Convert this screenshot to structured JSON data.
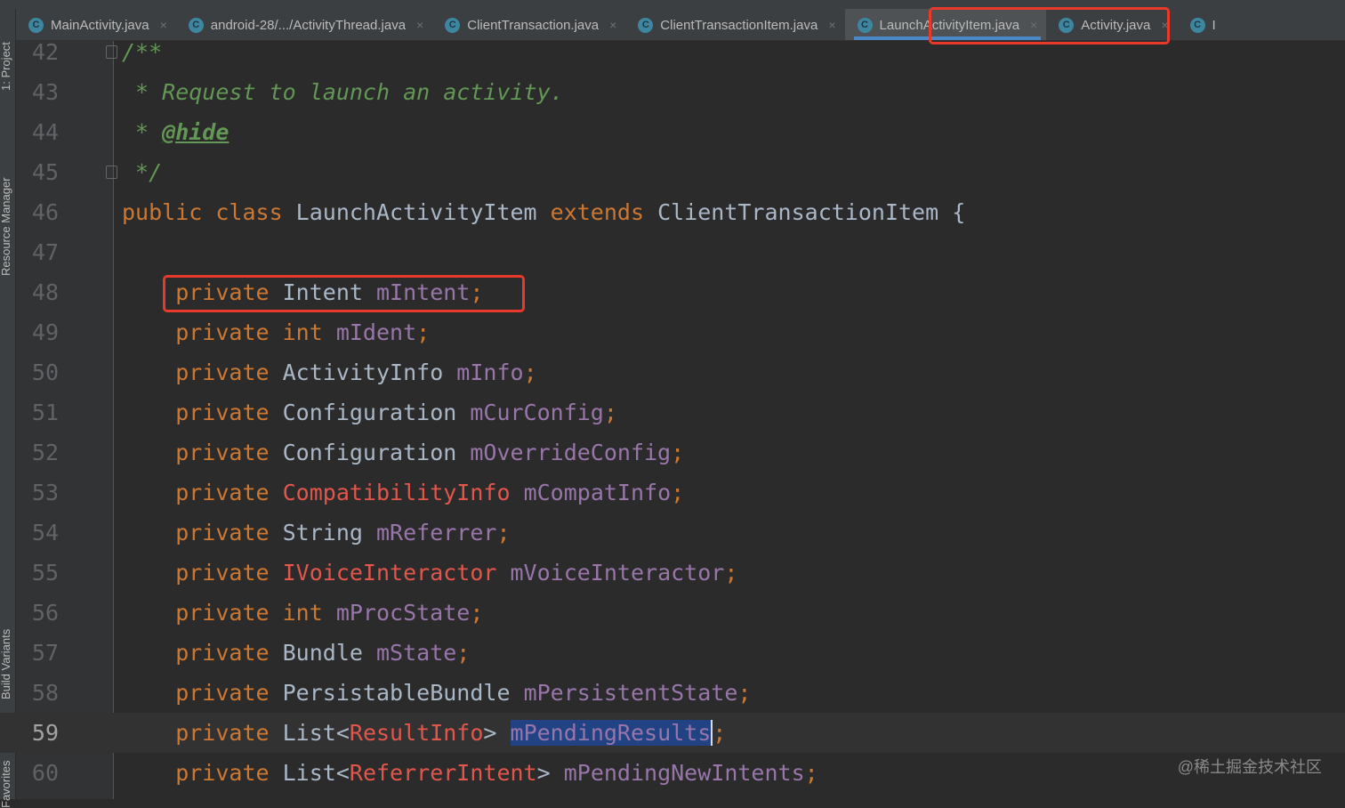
{
  "sidebar": {
    "items": [
      "1: Project",
      "Resource Manager",
      "Build Variants",
      "Favorites"
    ]
  },
  "tabs": [
    {
      "label": "MainActivity.java",
      "icon": "class-icon",
      "active": false
    },
    {
      "label": "android-28/.../ActivityThread.java",
      "icon": "class-icon",
      "active": false
    },
    {
      "label": "ClientTransaction.java",
      "icon": "class-icon",
      "active": false
    },
    {
      "label": "ClientTransactionItem.java",
      "icon": "abstract-class-icon",
      "active": false
    },
    {
      "label": "LaunchActivityItem.java",
      "icon": "class-icon",
      "active": true
    },
    {
      "label": "Activity.java",
      "icon": "class-icon",
      "active": false
    },
    {
      "label": "I",
      "icon": "class-icon",
      "active": false
    }
  ],
  "tab_close": "×",
  "icon_letter": "C",
  "code": {
    "current_line": "59",
    "lines": [
      {
        "n": "42",
        "t": [
          [
            "cm",
            "/**"
          ]
        ]
      },
      {
        "n": "43",
        "t": [
          [
            "cm",
            " * Request to launch an activity."
          ]
        ]
      },
      {
        "n": "44",
        "t": [
          [
            "cm",
            " * "
          ],
          [
            "tag",
            "@hide"
          ]
        ]
      },
      {
        "n": "45",
        "t": [
          [
            "cm",
            " */"
          ]
        ]
      },
      {
        "n": "46",
        "t": [
          [
            "kw",
            "public class "
          ],
          [
            "cls",
            "LaunchActivityItem "
          ],
          [
            "kw",
            "extends "
          ],
          [
            "cls",
            "ClientTransactionItem {"
          ]
        ]
      },
      {
        "n": "47",
        "t": []
      },
      {
        "n": "48",
        "t": [
          [
            "kw",
            "    private "
          ],
          [
            "cls",
            "Intent "
          ],
          [
            "fld",
            "mIntent"
          ],
          [
            "kw",
            ";"
          ]
        ]
      },
      {
        "n": "49",
        "t": [
          [
            "kw",
            "    private int "
          ],
          [
            "fld",
            "mIdent"
          ],
          [
            "kw",
            ";"
          ]
        ]
      },
      {
        "n": "50",
        "t": [
          [
            "kw",
            "    private "
          ],
          [
            "cls",
            "ActivityInfo "
          ],
          [
            "fld",
            "mInfo"
          ],
          [
            "kw",
            ";"
          ]
        ]
      },
      {
        "n": "51",
        "t": [
          [
            "kw",
            "    private "
          ],
          [
            "cls",
            "Configuration "
          ],
          [
            "fld",
            "mCurConfig"
          ],
          [
            "kw",
            ";"
          ]
        ]
      },
      {
        "n": "52",
        "t": [
          [
            "kw",
            "    private "
          ],
          [
            "cls",
            "Configuration "
          ],
          [
            "fld",
            "mOverrideConfig"
          ],
          [
            "kw",
            ";"
          ]
        ]
      },
      {
        "n": "53",
        "t": [
          [
            "kw",
            "    private "
          ],
          [
            "red",
            "CompatibilityInfo "
          ],
          [
            "fld",
            "mCompatInfo"
          ],
          [
            "kw",
            ";"
          ]
        ]
      },
      {
        "n": "54",
        "t": [
          [
            "kw",
            "    private "
          ],
          [
            "cls",
            "String "
          ],
          [
            "fld",
            "mReferrer"
          ],
          [
            "kw",
            ";"
          ]
        ]
      },
      {
        "n": "55",
        "t": [
          [
            "kw",
            "    private "
          ],
          [
            "red",
            "IVoiceInteractor "
          ],
          [
            "fld",
            "mVoiceInteractor"
          ],
          [
            "kw",
            ";"
          ]
        ]
      },
      {
        "n": "56",
        "t": [
          [
            "kw",
            "    private int "
          ],
          [
            "fld",
            "mProcState"
          ],
          [
            "kw",
            ";"
          ]
        ]
      },
      {
        "n": "57",
        "t": [
          [
            "kw",
            "    private "
          ],
          [
            "cls",
            "Bundle "
          ],
          [
            "fld",
            "mState"
          ],
          [
            "kw",
            ";"
          ]
        ]
      },
      {
        "n": "58",
        "t": [
          [
            "kw",
            "    private "
          ],
          [
            "cls",
            "PersistableBundle "
          ],
          [
            "fld",
            "mPersistentState"
          ],
          [
            "kw",
            ";"
          ]
        ]
      },
      {
        "n": "59",
        "t": [
          [
            "kw",
            "    private "
          ],
          [
            "cls",
            "List<"
          ],
          [
            "red",
            "ResultInfo"
          ],
          [
            "cls",
            "> "
          ],
          [
            "fld sel caret",
            "mPendingResults"
          ],
          [
            "kw",
            ";"
          ]
        ]
      },
      {
        "n": "60",
        "t": [
          [
            "kw",
            "    private "
          ],
          [
            "cls",
            "List<"
          ],
          [
            "red",
            "ReferrerIntent"
          ],
          [
            "cls",
            "> "
          ],
          [
            "fld",
            "mPendingNewIntents"
          ],
          [
            "kw",
            ";"
          ]
        ]
      }
    ]
  },
  "watermark": "@稀土掘金技术社区"
}
